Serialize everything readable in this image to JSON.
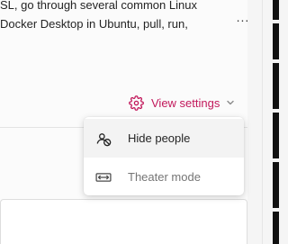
{
  "description": {
    "line1": "SL, go through several common Linux",
    "line2": "Docker Desktop in Ubuntu, pull, run,"
  },
  "more_button": {
    "label": "...",
    "icon": "more-horizontal-icon"
  },
  "view_settings": {
    "label": "View settings",
    "icon": "gear-icon",
    "chevron_icon": "chevron-down-icon",
    "accent_color": "#c2185b"
  },
  "menu": {
    "items": [
      {
        "label": "Hide people",
        "icon": "hide-people-icon",
        "state": "selected"
      },
      {
        "label": "Theater mode",
        "icon": "theater-mode-icon",
        "state": "default"
      }
    ]
  },
  "colors": {
    "text": "#242424",
    "muted_text": "#757575",
    "menu_background": "#ffffff",
    "selected_background": "#f3f3f3",
    "right_bar": "#111111"
  }
}
